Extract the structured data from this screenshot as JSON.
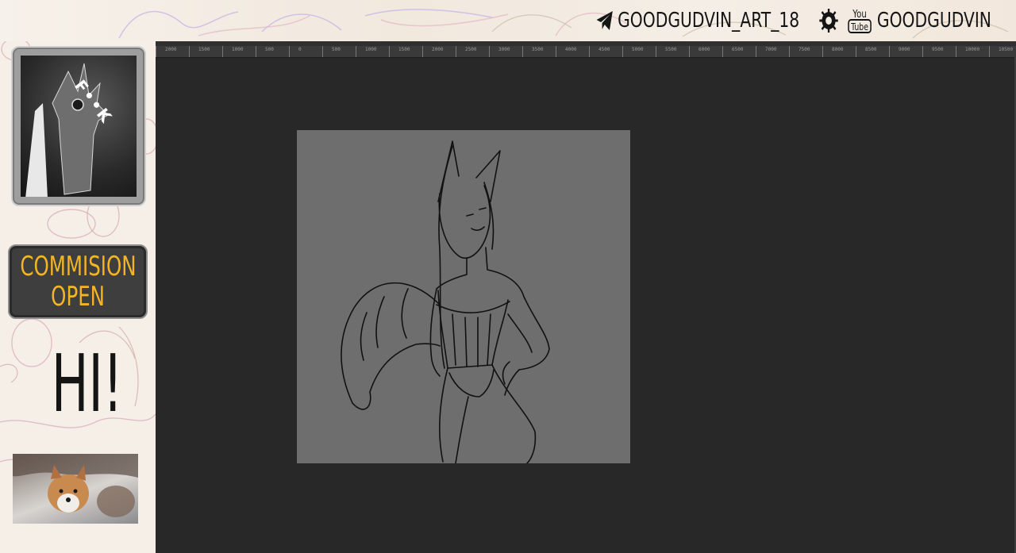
{
  "banner": {
    "telegram_handle": "GOODGUDVIN_ART_18",
    "youtube_handle": "GOODGUDVIN",
    "youtube_icon_top": "You",
    "youtube_icon_bottom": "Tube"
  },
  "sidebar": {
    "avatar_text": "F••K",
    "commission_line1": "COMMISION",
    "commission_line2": "OPEN",
    "greeting": "HI!"
  },
  "ruler": {
    "labels": [
      "2000",
      "1500",
      "1000",
      "500",
      "0",
      "500",
      "1000",
      "1500",
      "2000",
      "2500",
      "3000",
      "3500",
      "4000",
      "4500",
      "5000",
      "5500",
      "6000",
      "6500",
      "7000",
      "7500",
      "8000",
      "8500",
      "9000",
      "9500",
      "10000",
      "10500"
    ]
  },
  "colors": {
    "accent_orange": "#f4b524",
    "editor_bg": "#282828",
    "canvas_bg": "#6e6e6e"
  },
  "icons": [
    "telegram-icon",
    "paw-splat-icon",
    "youtube-icon"
  ]
}
